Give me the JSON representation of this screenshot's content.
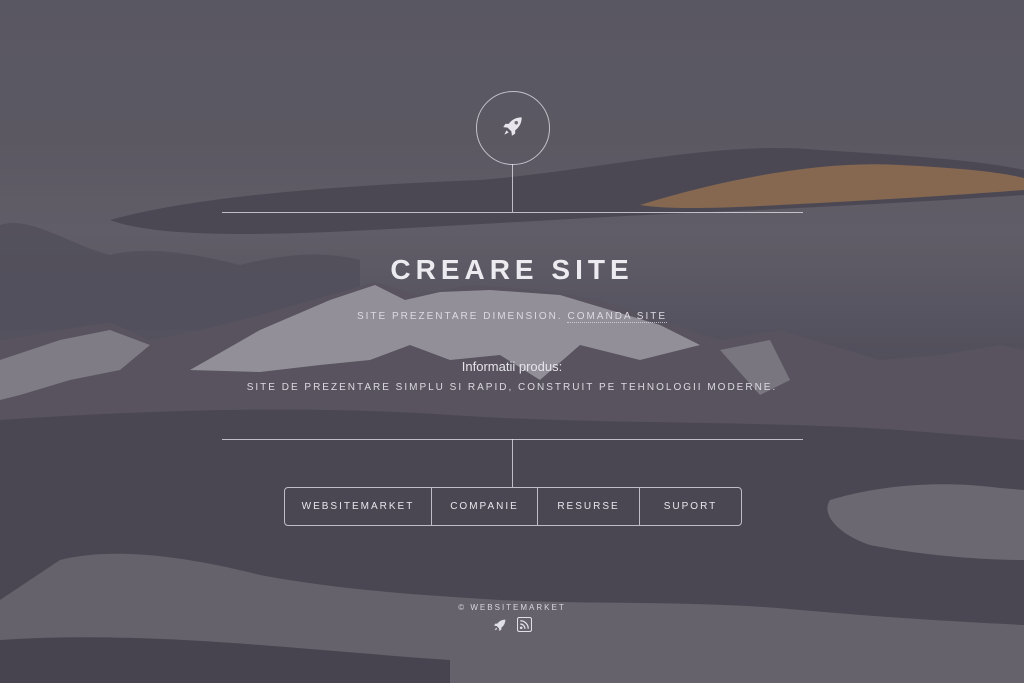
{
  "header": {
    "title": "CREARE SITE",
    "subtitle_text": "SITE PREZENTARE DIMENSION.",
    "subtitle_link": "COMANDA SITE",
    "logo_icon": "rocket-icon"
  },
  "info": {
    "label": "Informatii produs:",
    "text": "SITE DE PREZENTARE SIMPLU SI RAPID, CONSTRUIT PE TEHNOLOGII MODERNE."
  },
  "nav": {
    "items": [
      {
        "label": "WEBSITEMARKET"
      },
      {
        "label": "COMPANIE"
      },
      {
        "label": "RESURSE"
      },
      {
        "label": "SUPORT"
      }
    ]
  },
  "footer": {
    "copyright": "© WEBSITEMARKET",
    "icons": [
      "rocket-icon",
      "rss-icon"
    ]
  },
  "colors": {
    "text": "#ecebf0",
    "line": "#e6e4ec",
    "sky_sunset": "#c88a52"
  }
}
